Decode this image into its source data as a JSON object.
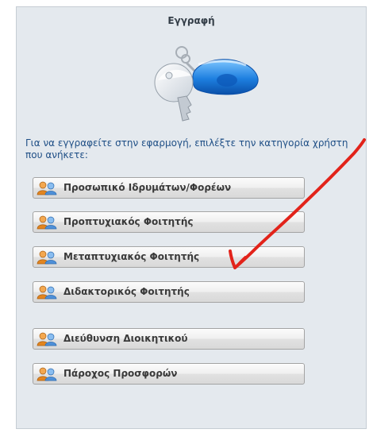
{
  "panel": {
    "title": "Εγγραφή",
    "hero_icon": "keys-icon",
    "instruction": "Για να εγγραφείτε στην εφαρμογή, επιλέξτε την κατηγορία χρήστη που ανήκετε:",
    "button_icon": "users-icon"
  },
  "buttons": [
    {
      "label": "Προσωπικό Ιδρυμάτων/Φορέων"
    },
    {
      "label": "Προπτυχιακός Φοιτητής"
    },
    {
      "label": "Μεταπτυχιακός Φοιτητής"
    },
    {
      "label": "Διδακτορικός Φοιτητής"
    },
    {
      "label": "Διεύθυνση Διοικητικού"
    },
    {
      "label": "Πάροχος Προσφορών"
    }
  ],
  "annotation": {
    "type": "hand-drawn checkmark",
    "color": "#e2231a",
    "marks_button": "Μεταπτυχιακός Φοιτητής"
  },
  "colors": {
    "panel_background": "#e4e9ee",
    "instruction_text": "#1f4f86",
    "button_text": "#3a3a3a"
  }
}
